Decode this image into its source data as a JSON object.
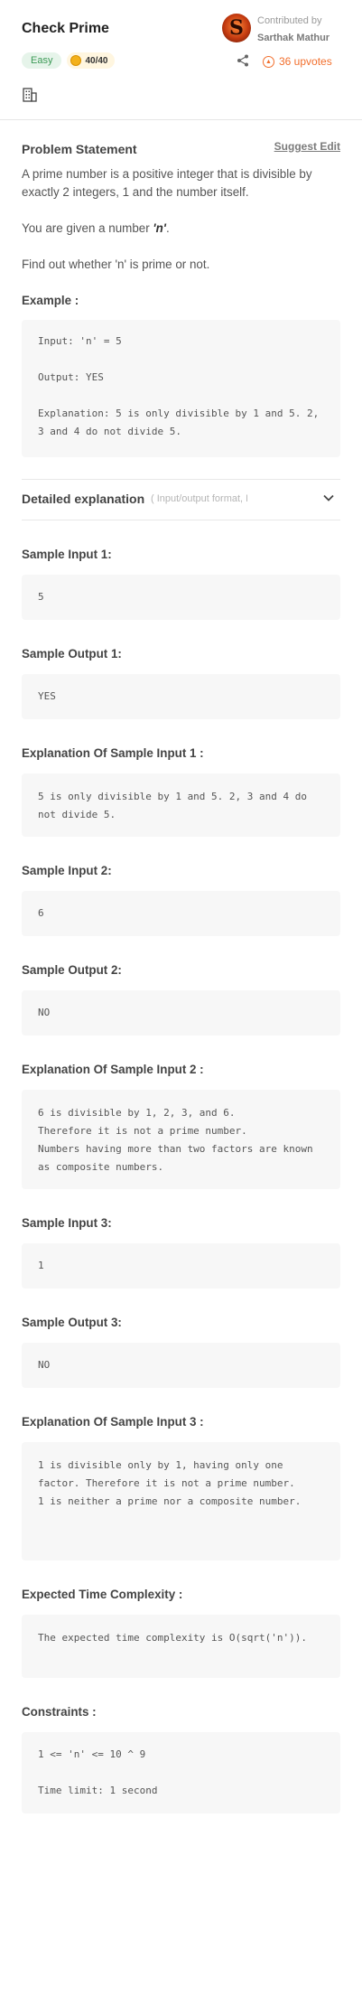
{
  "header": {
    "title": "Check Prime",
    "difficulty": "Easy",
    "score": "40/40",
    "contributed_by_label": "Contributed by",
    "contributor_name": "Sarthak Mathur",
    "avatar_letter": "S",
    "upvotes": "36 upvotes"
  },
  "problem": {
    "heading": "Problem Statement",
    "suggest_edit": "Suggest Edit",
    "para1": "A prime number is a positive integer that is divisible by exactly 2 integers, 1 and the number itself.",
    "para2_prefix": "You are given a number ",
    "para2_var": "'n'",
    "para2_suffix": ".",
    "para3": "Find out whether 'n' is prime or not."
  },
  "example": {
    "label": "Example :",
    "code": "Input: 'n' = 5\n\nOutput: YES\n\nExplanation: 5 is only divisible by 1 and 5. 2, 3 and 4 do not divide 5."
  },
  "detailed": {
    "title": "Detailed explanation",
    "subtitle": "( Input/output format, Notes, Im"
  },
  "sections": [
    {
      "label": "Sample Input 1:",
      "code": "5"
    },
    {
      "label": "Sample Output 1:",
      "code": "YES"
    },
    {
      "label": "Explanation Of Sample Input 1 :",
      "code": "5 is only divisible by 1 and 5. 2, 3 and 4 do not divide 5."
    },
    {
      "label": "Sample Input 2:",
      "code": "6"
    },
    {
      "label": "Sample Output 2:",
      "code": "NO"
    },
    {
      "label": "Explanation Of Sample Input 2 :",
      "code": "6 is divisible by 1, 2, 3, and 6.\nTherefore it is not a prime number.\nNumbers having more than two factors are known as composite numbers."
    },
    {
      "label": "Sample Input 3:",
      "code": "1"
    },
    {
      "label": "Sample Output 3:",
      "code": "NO"
    },
    {
      "label": "Explanation Of Sample Input 3 :",
      "code": "1 is divisible only by 1, having only one factor. Therefore it is not a prime number.\n1 is neither a prime nor a composite number."
    },
    {
      "label": "Expected Time Complexity :",
      "code": "The expected time complexity is O(sqrt('n'))."
    },
    {
      "label": "Constraints :",
      "code": "1 <= 'n' <= 10 ^ 9\n\nTime limit: 1 second"
    }
  ],
  "colors": {
    "accent": "#f26f2d",
    "easy_bg": "#e6f4ea",
    "easy_text": "#3d9a57",
    "code_bg": "#f7f7f7"
  },
  "icons": [
    "company-icon",
    "share-icon",
    "upvote-icon",
    "chevron-down-icon",
    "coin-icon"
  ]
}
